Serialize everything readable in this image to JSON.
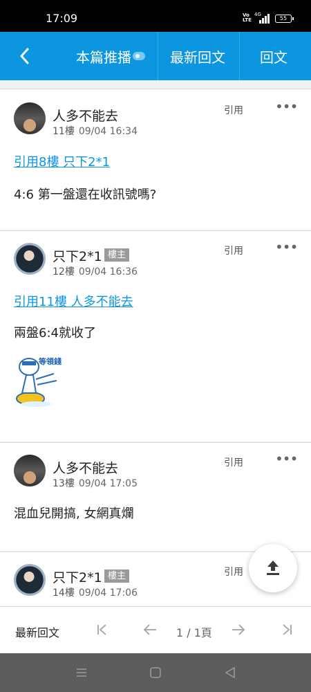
{
  "status_bar": {
    "time": "17:09",
    "volte": "Vo\nLTE",
    "network": "4G",
    "battery": "55"
  },
  "top_nav": {
    "title": "本篇推播",
    "latest": "最新回文",
    "reply": "回文"
  },
  "posts": [
    {
      "author": "人多不能去",
      "floor": "11樓",
      "datetime": "09/04 16:34",
      "quote_action": "引用",
      "quoted_link": "引用8樓 只下2*1",
      "text": "4:6 第一盤還在收訊號嗎?"
    },
    {
      "author": "只下2*1",
      "badge": "樓主",
      "floor": "12樓",
      "datetime": "09/04 16:36",
      "quote_action": "引用",
      "quoted_link": "引用11樓 人多不能去",
      "text": "兩盤6:4就收了",
      "sticker_text": "等領錢"
    },
    {
      "author": "人多不能去",
      "floor": "13樓",
      "datetime": "09/04 17:05",
      "quote_action": "引用",
      "text": "混血兒開搞, 女網真爛"
    },
    {
      "author": "只下2*1",
      "badge": "樓主",
      "floor": "14樓",
      "datetime": "09/04 17:06",
      "quote_action": "引用"
    }
  ],
  "more_icon": "more-horizontal-icon",
  "scroll_top_icon": "upload-arrow-icon",
  "pager": {
    "latest": "最新回文",
    "page": "1 / 1頁"
  },
  "colors": {
    "primary": "#0d96e0",
    "link": "#0d96e0",
    "badge": "#9a9a9a"
  }
}
